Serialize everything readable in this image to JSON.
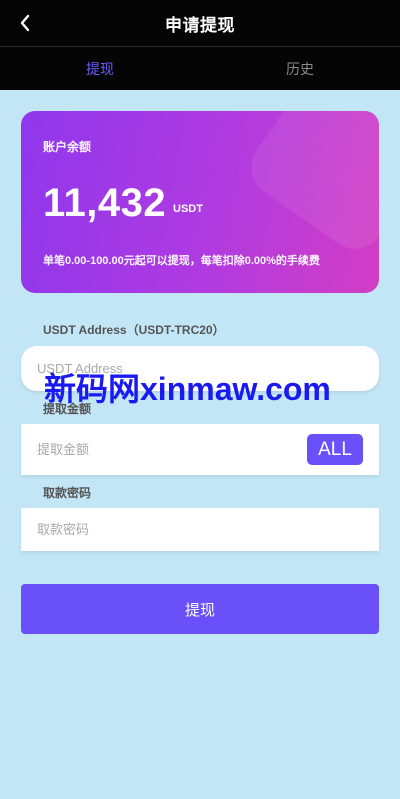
{
  "header": {
    "title": "申请提现",
    "back_icon": "chevron-left-icon"
  },
  "tabs": [
    {
      "label": "提现",
      "active": true
    },
    {
      "label": "历史",
      "active": false
    }
  ],
  "balance_card": {
    "label": "账户余额",
    "amount": "11,432",
    "unit": "USDT",
    "note": "单笔0.00-100.00元起可以提现，每笔扣除0.00%的手续费"
  },
  "address_field": {
    "label": "USDT Address（USDT-TRC20）",
    "placeholder": "USDT Address",
    "value": ""
  },
  "amount_field": {
    "label": "提取金额",
    "placeholder": "提取金额",
    "value": "",
    "all_label": "ALL"
  },
  "password_field": {
    "label": "取款密码",
    "placeholder": "取款密码",
    "value": ""
  },
  "submit_label": "提现",
  "watermark": "新码网xinmaw.com",
  "colors": {
    "accent": "#6a50f8",
    "page_bg": "#c2e6f6",
    "header_bg": "#050505",
    "active_tab": "#6a5cff",
    "watermark": "#1a1af0"
  }
}
